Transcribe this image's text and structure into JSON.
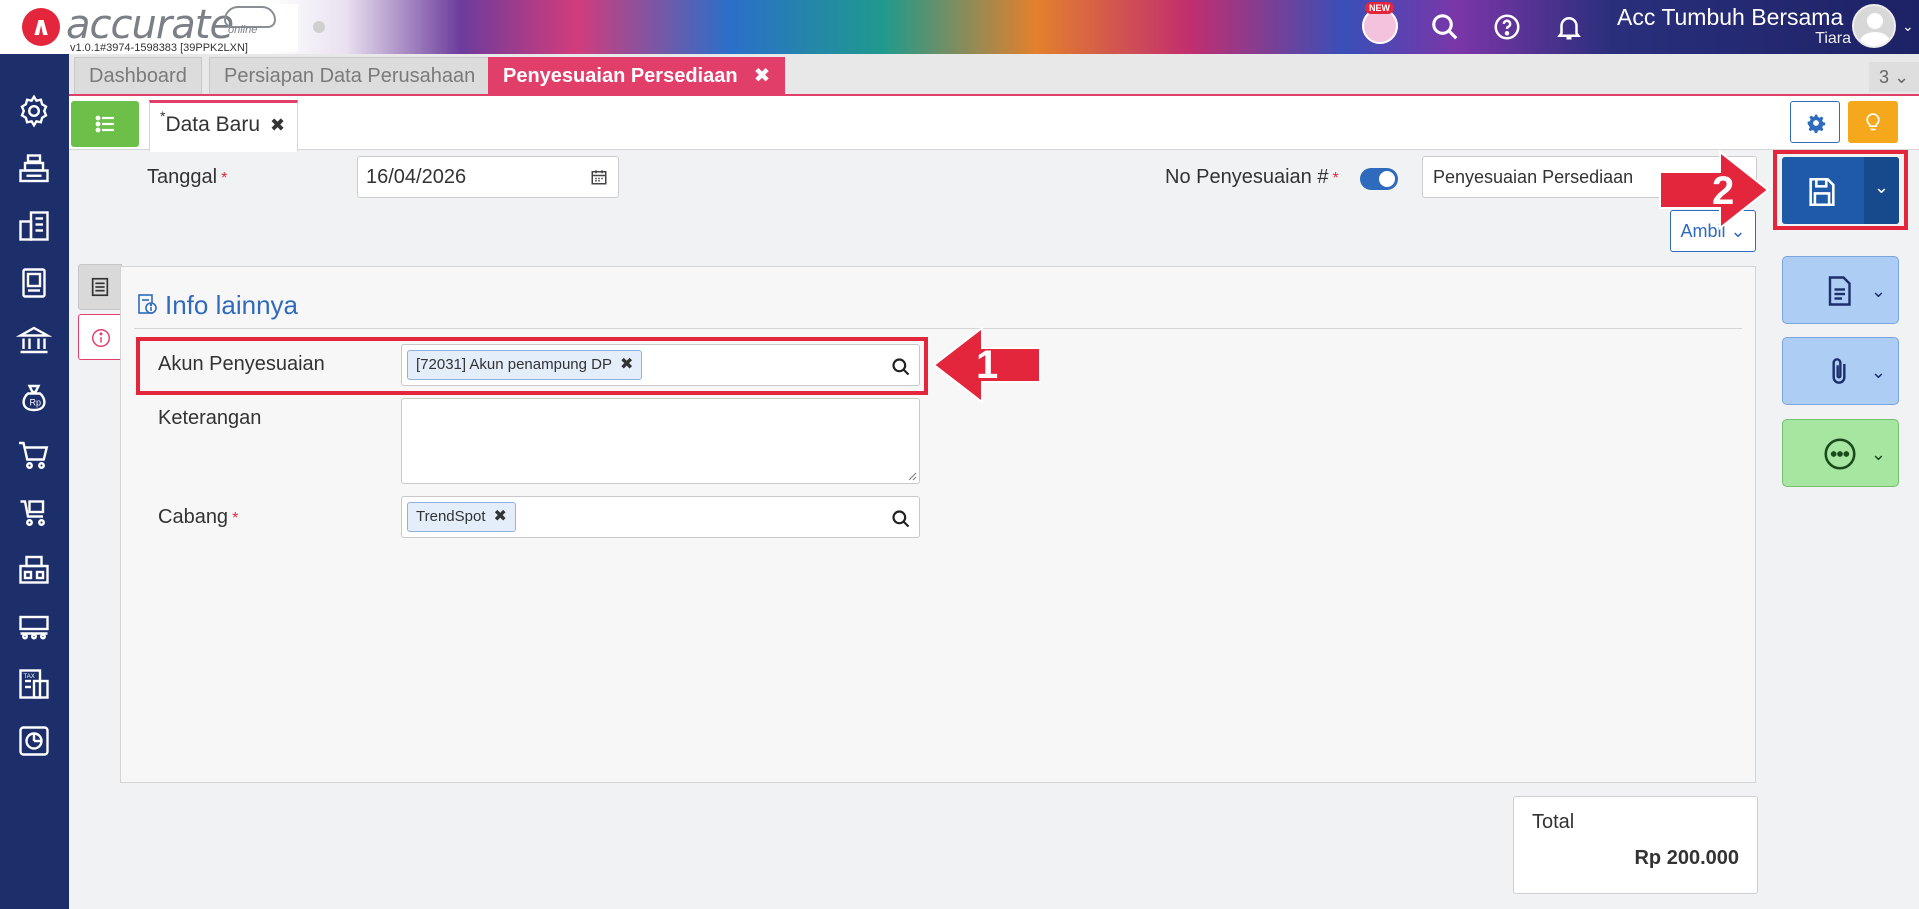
{
  "app": {
    "logo_text": "accurate",
    "logo_sub": "online",
    "version": "v1.0.1#3974-1598383 [39PPK2LXN]",
    "new_badge": "NEW",
    "company": "Acc Tumbuh Bersama",
    "user": "Tiara"
  },
  "tabs": [
    {
      "label": "Dashboard"
    },
    {
      "label": "Persiapan Data Perusahaan"
    },
    {
      "label": "Penyesuaian Persediaan",
      "close": "✖"
    }
  ],
  "tab_count": "3",
  "subtab": {
    "label": "Data Baru",
    "close": "✖"
  },
  "form": {
    "tanggal_label": "Tanggal",
    "required_mark": "*",
    "tanggal_value": "16/04/2026",
    "no_label": "No Penyesuaian #",
    "no_value": "Penyesuaian Persediaan",
    "ambil_label": "Ambil"
  },
  "panel": {
    "title": "Info lainnya",
    "akun_label": "Akun Penyesuaian",
    "akun_chip": "[72031] Akun penampung DP",
    "keterangan_label": "Keterangan",
    "keterangan_value": "",
    "cabang_label": "Cabang",
    "cabang_chip": "TrendSpot"
  },
  "annotations": {
    "one": "1",
    "two": "2"
  },
  "total": {
    "label": "Total",
    "value": "Rp 200.000"
  },
  "colors": {
    "accent": "#e23e6a",
    "primary": "#1e5aa8",
    "sidebar": "#1c2f6b",
    "annotation": "#e3263b"
  }
}
